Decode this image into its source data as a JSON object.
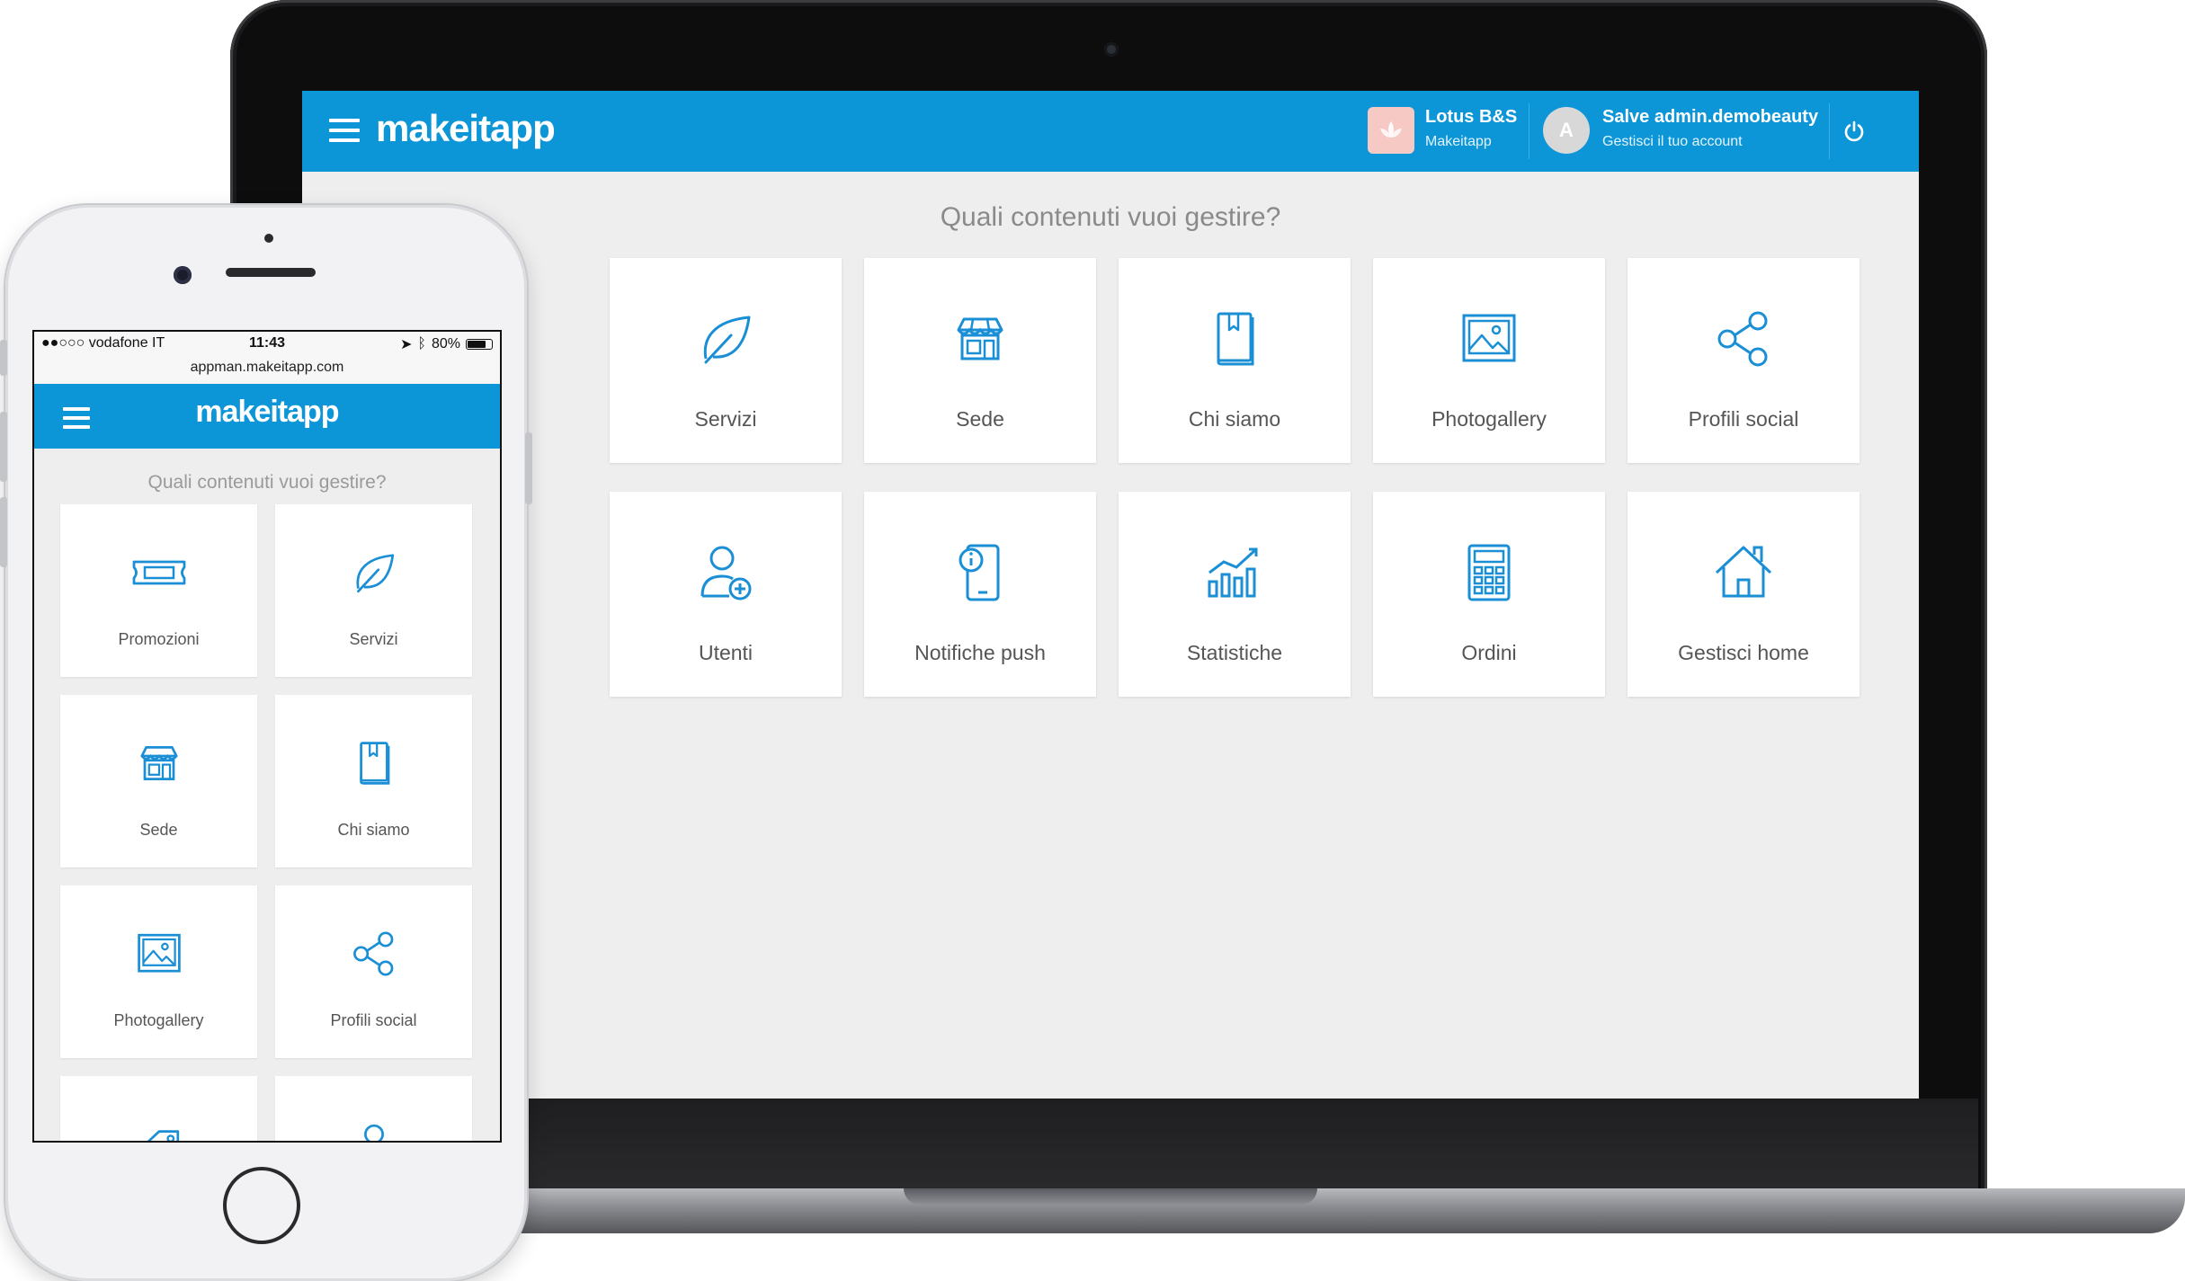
{
  "desktop": {
    "logo": "makeitapp",
    "app": {
      "name": "Lotus B&S",
      "subtitle": "Makeitapp"
    },
    "user": {
      "avatar_letter": "A",
      "greeting": "Salve admin.demobeauty",
      "subtitle": "Gestisci il tuo account"
    },
    "question": "Quali contenuti vuoi gestire?",
    "tiles": [
      {
        "label": "Servizi",
        "icon": "leaf-icon"
      },
      {
        "label": "Sede",
        "icon": "store-icon"
      },
      {
        "label": "Chi siamo",
        "icon": "book-icon"
      },
      {
        "label": "Photogallery",
        "icon": "image-icon"
      },
      {
        "label": "Profili social",
        "icon": "share-icon"
      },
      {
        "label": "Utenti",
        "icon": "user-add-icon"
      },
      {
        "label": "Notifiche push",
        "icon": "phone-info-icon"
      },
      {
        "label": "Statistiche",
        "icon": "chart-icon"
      },
      {
        "label": "Ordini",
        "icon": "calculator-icon"
      },
      {
        "label": "Gestisci home",
        "icon": "home-icon"
      }
    ]
  },
  "mobile": {
    "status": {
      "carrier": "●●○○○ vodafone IT",
      "time": "11:43",
      "battery": "80%",
      "battery_level": 0.8
    },
    "url": "appman.makeitapp.com",
    "logo": "makeitapp",
    "question": "Quali contenuti vuoi gestire?",
    "tiles": [
      {
        "label": "Promozioni",
        "icon": "ticket-icon"
      },
      {
        "label": "Servizi",
        "icon": "leaf-icon"
      },
      {
        "label": "Sede",
        "icon": "store-icon"
      },
      {
        "label": "Chi siamo",
        "icon": "book-icon"
      },
      {
        "label": "Photogallery",
        "icon": "image-icon"
      },
      {
        "label": "Profili social",
        "icon": "share-icon"
      }
    ]
  },
  "colors": {
    "brand": "#0c96d8",
    "icon": "#1a8fd6",
    "tile_text": "#555555"
  }
}
